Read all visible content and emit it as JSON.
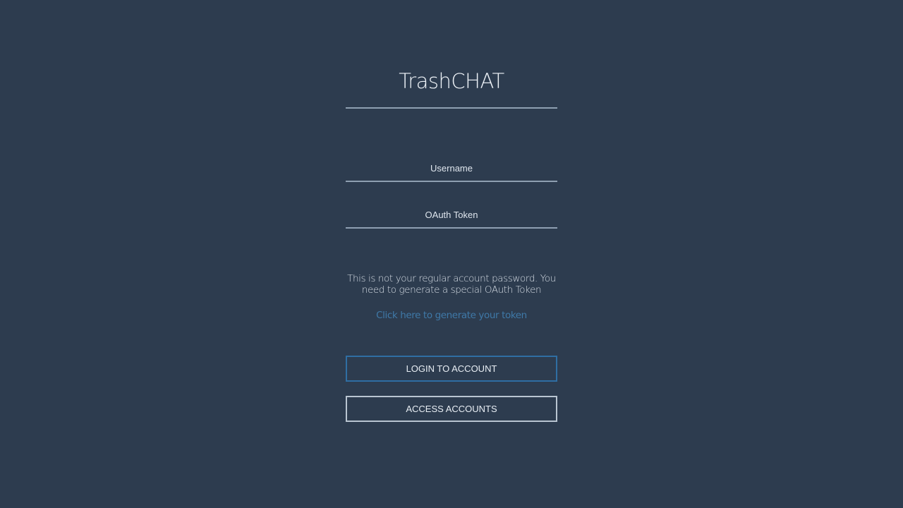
{
  "app": {
    "title": "TrashCHAT"
  },
  "form": {
    "username": {
      "value": "",
      "placeholder": "Username"
    },
    "token": {
      "value": "",
      "placeholder": "OAuth Token"
    },
    "note": "This is not your regular account password. You need to generate a special OAuth Token",
    "token_link": "Click here to generate your token",
    "login_label": "LOGIN TO ACCOUNT",
    "access_label": "ACCESS ACCOUNTS"
  },
  "colors": {
    "background": "#2d3c4f",
    "link": "#3f79a8",
    "login_border": "#2f6ea3"
  }
}
